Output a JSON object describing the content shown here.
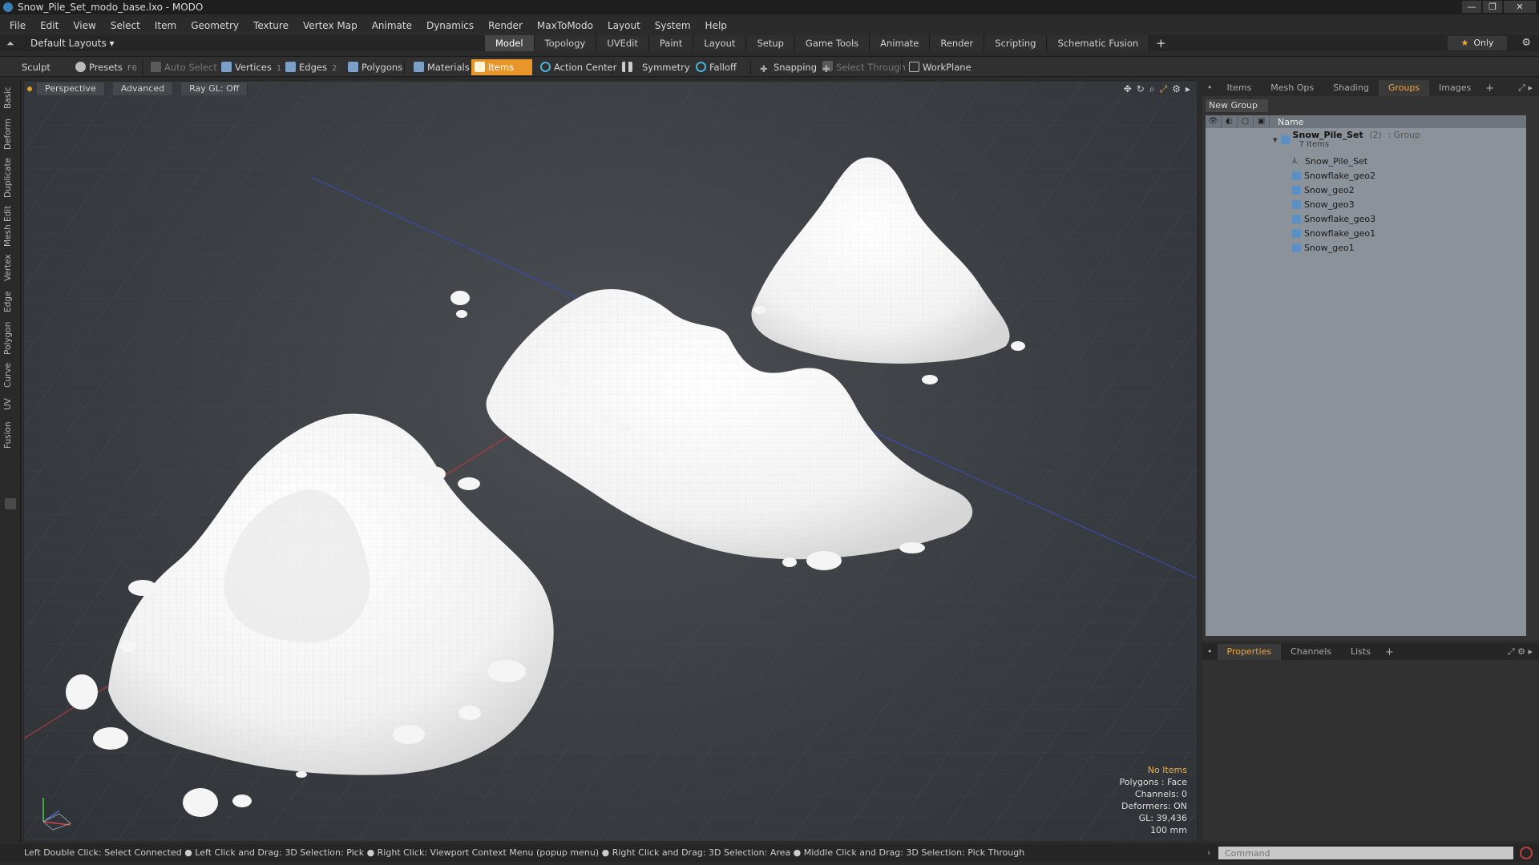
{
  "window": {
    "title": "Snow_Pile_Set_modo_base.lxo - MODO",
    "min": "—",
    "max": "❐",
    "close": "✕"
  },
  "menu": [
    "File",
    "Edit",
    "View",
    "Select",
    "Item",
    "Geometry",
    "Texture",
    "Vertex Map",
    "Animate",
    "Dynamics",
    "Render",
    "MaxToModo",
    "Layout",
    "System",
    "Help"
  ],
  "layoutbar": {
    "layout_dropdown": "Default Layouts ▾",
    "tabs": [
      "Model",
      "Topology",
      "UVEdit",
      "Paint",
      "Layout",
      "Setup",
      "Game Tools",
      "Animate",
      "Render",
      "Scripting",
      "Schematic Fusion"
    ],
    "active_tab": "Model",
    "plus": "+",
    "only_label": "Only"
  },
  "toolbar": {
    "sculpt": "Sculpt",
    "presets": "Presets",
    "presets_key": "F6",
    "auto_select": "Auto Select",
    "vertices": "Vertices",
    "vertices_key": "1",
    "edges": "Edges",
    "edges_key": "2",
    "polygons": "Polygons",
    "materials": "Materials",
    "items": "Items",
    "action_center": "Action Center",
    "symmetry": "Symmetry",
    "falloff": "Falloff",
    "snapping": "Snapping",
    "select_through": "Select Through",
    "workplane": "WorkPlane"
  },
  "left_tabs": [
    "Basic",
    "Deform",
    "Duplicate",
    "Mesh Edit",
    "Vertex",
    "Edge",
    "Polygon",
    "Curve",
    "UV",
    "Fusion"
  ],
  "viewport": {
    "view_mode": "Perspective",
    "shading": "Advanced",
    "raygl": "Ray GL: Off",
    "info": {
      "selection": "No Items",
      "polygons": "Polygons : Face",
      "channels": "Channels: 0",
      "deformers": "Deformers: ON",
      "gl": "GL: 39,436",
      "scale": "100 mm"
    }
  },
  "items_panel": {
    "tabs": [
      "Items",
      "Mesh Ops",
      "Shading",
      "Groups",
      "Images"
    ],
    "active_tab": "Groups",
    "new_group": "New Group",
    "name_header": "Name",
    "group": {
      "name": "Snow_Pile_Set",
      "count": "(2)",
      "type": ": Group",
      "sub": "7 Items"
    },
    "children": [
      "Snow_Pile_Set",
      "Snowflake_geo2",
      "Snow_geo2",
      "Snow_geo3",
      "Snowflake_geo3",
      "Snowflake_geo1",
      "Snow_geo1"
    ]
  },
  "properties_panel": {
    "tabs": [
      "Properties",
      "Channels",
      "Lists"
    ],
    "active_tab": "Properties"
  },
  "status": "Left Double Click: Select Connected ● Left Click and Drag: 3D Selection: Pick ● Right Click: Viewport Context Menu (popup menu) ● Right Click and Drag: 3D Selection: Area ● Middle Click and Drag: 3D Selection: Pick Through",
  "command": {
    "placeholder": "Command"
  },
  "colors": {
    "accent": "#e8962a",
    "viewport_bg": "#3a3e42",
    "list_bg": "#8c9299"
  }
}
